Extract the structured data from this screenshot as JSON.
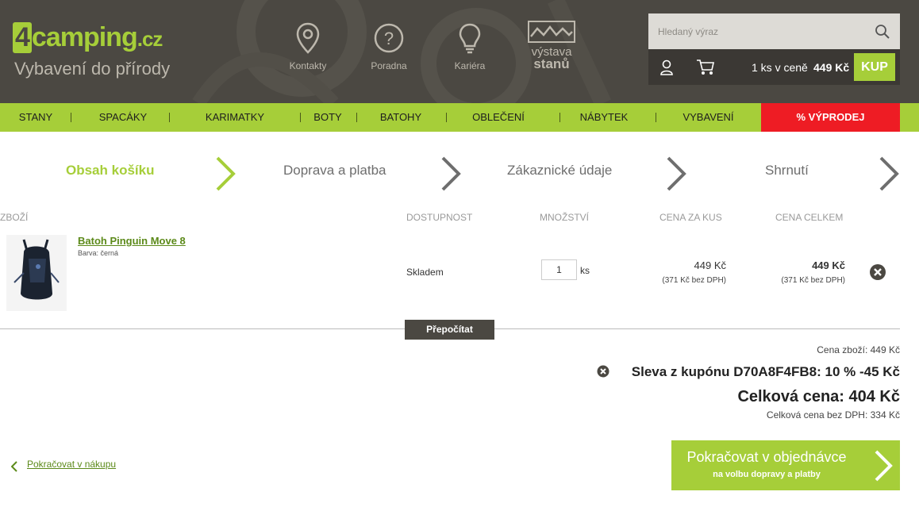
{
  "header": {
    "logo": {
      "prefix": "4",
      "brand": "camping",
      "tld": ".cz"
    },
    "tagline": "Vybavení do přírody",
    "nav": [
      {
        "label": "Kontakty",
        "icon": "location-pin-icon"
      },
      {
        "label": "Poradna",
        "icon": "question-icon"
      },
      {
        "label": "Kariéra",
        "icon": "lightbulb-icon"
      }
    ],
    "exhibition": {
      "line1": "výstava",
      "line2": "stanů"
    },
    "search": {
      "placeholder": "Hledaný výraz"
    },
    "cart": {
      "summary": "1 ks v ceně",
      "price": "449 Kč",
      "buy_label": "KUP"
    }
  },
  "main_nav": {
    "items": [
      "STANY",
      "SPACÁKY",
      "KARIMATKY",
      "BOTY",
      "BATOHY",
      "OBLEČENÍ",
      "NÁBYTEK",
      "VYBAVENÍ"
    ],
    "sale": "% VÝPRODEJ"
  },
  "steps": [
    "Obsah košíku",
    "Doprava a platba",
    "Zákaznické údaje",
    "Shrnutí"
  ],
  "table": {
    "headers": [
      "ZBOŽÍ",
      "DOSTUPNOST",
      "MNOŽSTVÍ",
      "CENA ZA KUS",
      "CENA CELKEM"
    ],
    "row": {
      "name": "Batoh Pinguin Move 8",
      "attr": "Barva: černá",
      "availability": "Skladem",
      "qty": "1",
      "qty_unit": "ks",
      "unit_price": "449 Kč",
      "unit_price_net": "(371 Kč bez DPH)",
      "total_price": "449 Kč",
      "total_price_net": "(371 Kč bez DPH)"
    },
    "recalc_label": "Přepočítat"
  },
  "totals": {
    "goods": "Cena zboží: 449 Kč",
    "coupon": "Sleva z kupónu D70A8F4FB8: 10 % -45 Kč",
    "grand": "Celková cena: 404 Kč",
    "grand_net": "Celková cena bez DPH: 334 Kč"
  },
  "actions": {
    "back": "Pokračovat v nákupu",
    "continue_main": "Pokračovat v objednávce",
    "continue_sub": "na volbu dopravy a platby"
  },
  "colors": {
    "accent": "#a6ce39",
    "header": "#4b4842",
    "sale": "#ee1c24",
    "link": "#5c8a1a"
  }
}
